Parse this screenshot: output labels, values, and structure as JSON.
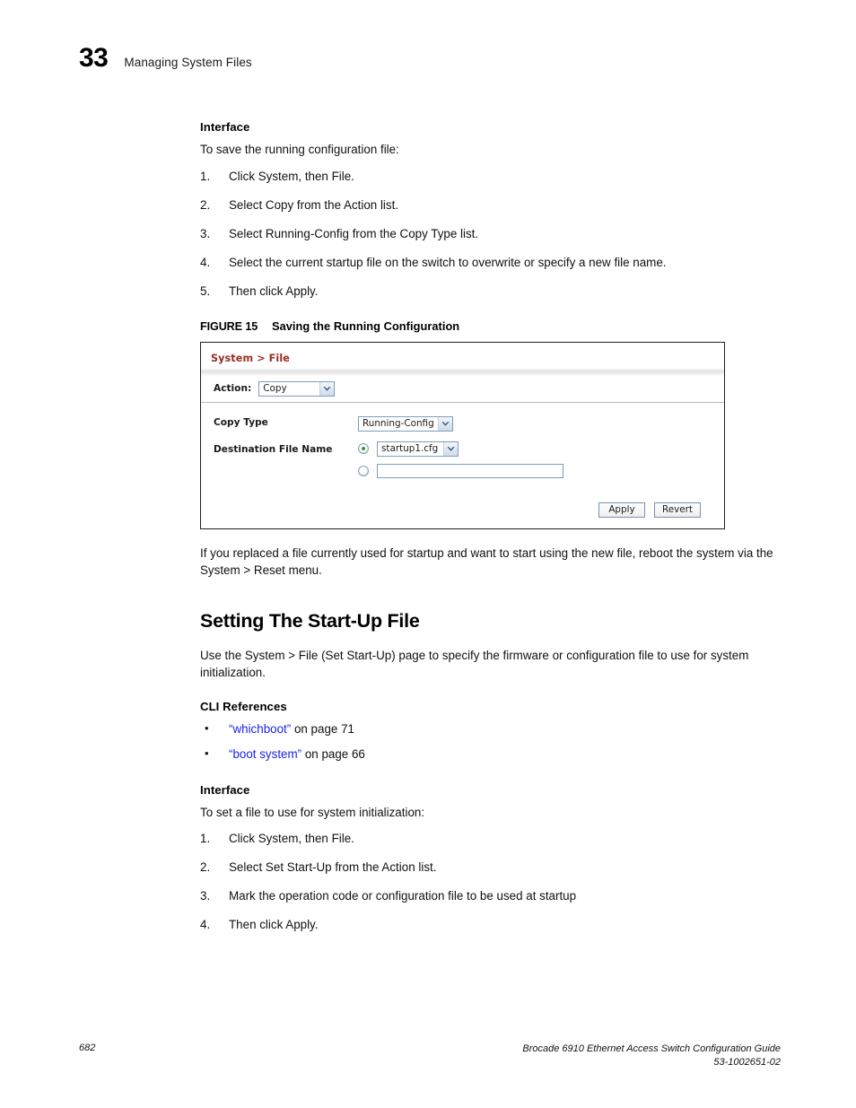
{
  "page": {
    "chapter_number": "33",
    "chapter_title": "Managing System Files",
    "footer_page_number": "682",
    "footer_guide_title": "Brocade 6910 Ethernet Access Switch Configuration Guide",
    "footer_doc_number": "53-1002651-02",
    "link_color": "#1a24e8",
    "screenshot_title_color": "#9a2b22",
    "radio_selected_color": "#2e9e2e"
  },
  "section_one": {
    "interface_heading": "Interface",
    "intro": "To save the running configuration file:",
    "steps": [
      {
        "num": "1.",
        "text": "Click System, then File."
      },
      {
        "num": "2.",
        "text": "Select Copy from the Action list."
      },
      {
        "num": "3.",
        "text": "Select Running-Config from the Copy Type list."
      },
      {
        "num": "4.",
        "text": "Select the current startup file on the switch to overwrite or specify a new file name."
      },
      {
        "num": "5.",
        "text": "Then click Apply."
      }
    ]
  },
  "figure": {
    "label": "FIGURE 15",
    "title": "Saving the Running Configuration",
    "screenshot": {
      "breadcrumb": "System > File",
      "action_label": "Action:",
      "action_value": "Copy",
      "copy_type_label": "Copy Type",
      "copy_type_value": "Running-Config",
      "destination_label": "Destination File Name",
      "destination_file_value": "startup1.cfg",
      "destination_custom_value": "",
      "destination_custom_placeholder": "",
      "apply_label": "Apply",
      "revert_label": "Revert"
    }
  },
  "after_figure": {
    "paragraph": "If you replaced a file currently used for startup and want to start using the new file, reboot the system via the System > Reset menu."
  },
  "section_two": {
    "heading": "Setting The Start-Up File",
    "intro": "Use the System > File (Set Start-Up) page to specify the firmware or configuration file to use for system initialization.",
    "cli_heading": "CLI References",
    "cli_links": [
      {
        "bullet": "•",
        "link": "“whichboot”",
        "suffix": " on page 71"
      },
      {
        "bullet": "•",
        "link": "“boot system”",
        "suffix": " on page 66"
      }
    ],
    "interface_heading": "Interface",
    "interface_intro": "To set a file to use for system initialization:",
    "steps": [
      {
        "num": "1.",
        "text": "Click System, then File."
      },
      {
        "num": "2.",
        "text": "Select Set Start-Up from the Action list."
      },
      {
        "num": "3.",
        "text": "Mark the operation code or configuration file to be used at startup"
      },
      {
        "num": "4.",
        "text": "Then click Apply."
      }
    ]
  }
}
